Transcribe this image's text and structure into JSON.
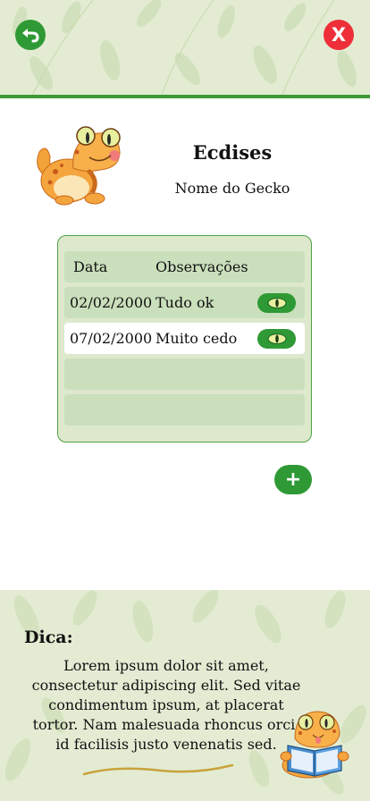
{
  "header": {
    "back_icon": "back-arrow-icon",
    "close_label": "X"
  },
  "page": {
    "title": "Ecdises",
    "subtitle": "Nome do Gecko"
  },
  "table": {
    "columns": [
      "Data",
      "Observações"
    ],
    "rows": [
      {
        "date": "02/02/2000",
        "note": "Tudo ok",
        "action_icon": "eye-icon"
      },
      {
        "date": "07/02/2000",
        "note": "Muito cedo",
        "action_icon": "eye-icon"
      },
      {
        "date": "",
        "note": ""
      },
      {
        "date": "",
        "note": ""
      }
    ]
  },
  "add_button": {
    "label": "+"
  },
  "tip": {
    "title": "Dica:",
    "text": "Lorem ipsum dolor sit amet, consectetur adipiscing elit. Sed vitae condimentum ipsum, at placerat tortor. Nam malesuada rhoncus orci, id facilisis justo venenatis sed."
  },
  "colors": {
    "primary_green": "#2f9a35",
    "danger_red": "#ee2f39",
    "pattern_background": "#e3ecd3",
    "table_background": "#dde8cd",
    "row_green": "#cadfbc"
  }
}
